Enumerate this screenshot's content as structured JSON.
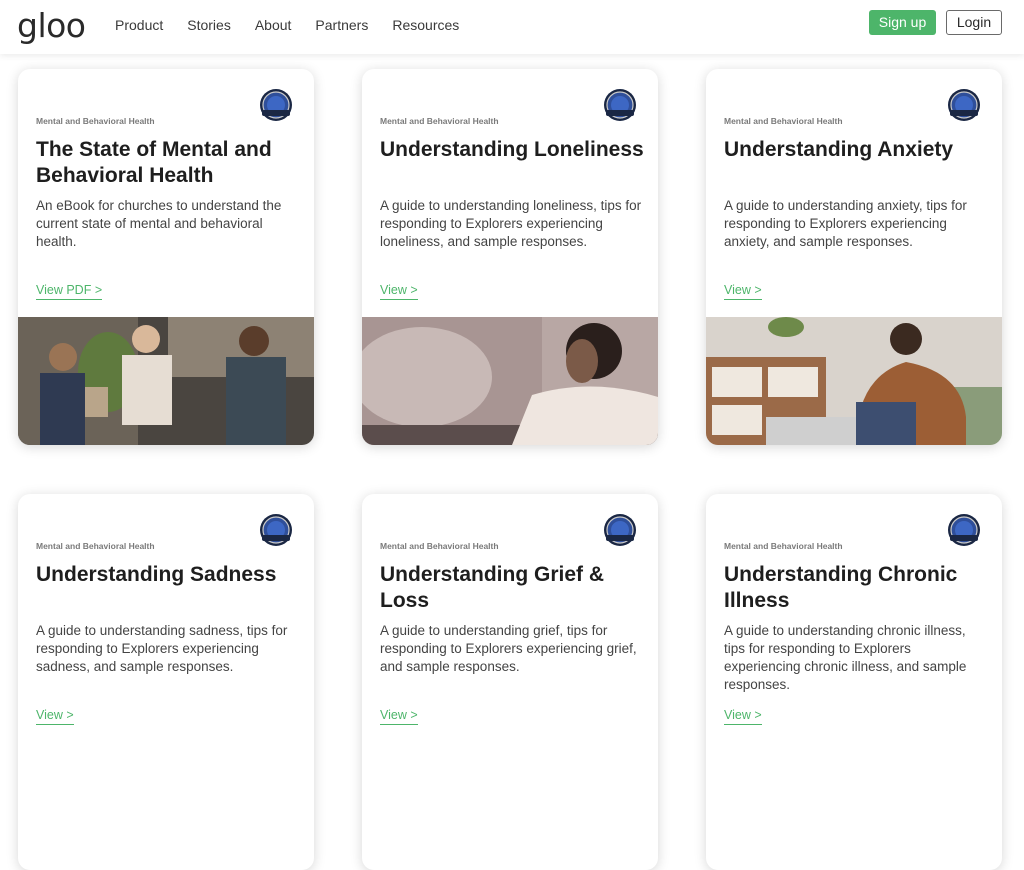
{
  "header": {
    "logo": "gloo",
    "nav": [
      "Product",
      "Stories",
      "About",
      "Partners",
      "Resources"
    ],
    "signup_label": "Sign up",
    "login_label": "Login"
  },
  "colors": {
    "accent": "#4db56a",
    "text_dark": "#1e1e1e"
  },
  "cards": [
    {
      "category": "Mental and Behavioral Health",
      "title": "The State of Mental and Behavioral Health",
      "description": "An eBook for churches to understand the current state of mental and behavioral health.",
      "link": "View PDF >",
      "badge_icon": "amct-seal-icon",
      "photo": "group-therapy-photo"
    },
    {
      "category": "Mental and Behavioral Health",
      "title": "Understanding Loneliness",
      "description": "A guide to understanding loneliness, tips for responding to Explorers experiencing loneliness, and sample responses.",
      "link": "View >",
      "badge_icon": "amct-seal-icon",
      "photo": "woman-window-photo"
    },
    {
      "category": "Mental and Behavioral Health",
      "title": "Understanding Anxiety",
      "description": "A guide to understanding anxiety, tips for responding to Explorers experiencing anxiety, and sample responses.",
      "link": "View >",
      "badge_icon": "amct-seal-icon",
      "photo": "man-couch-photo"
    },
    {
      "category": "Mental and Behavioral Health",
      "title": "Understanding Sadness",
      "description": "A guide to understanding sadness, tips for responding to Explorers experiencing sadness, and sample responses.",
      "link": "View >",
      "badge_icon": "amct-seal-icon"
    },
    {
      "category": "Mental and Behavioral Health",
      "title": "Understanding Grief & Loss",
      "description": "A guide to understanding grief, tips for responding to Explorers experiencing grief, and sample responses.",
      "link": "View >",
      "badge_icon": "amct-seal-icon"
    },
    {
      "category": "Mental and Behavioral Health",
      "title": "Understanding Chronic Illness",
      "description": "A guide to understanding chronic illness, tips for responding to Explorers experiencing chronic illness, and sample responses.",
      "link": "View >",
      "badge_icon": "amct-seal-icon"
    }
  ]
}
